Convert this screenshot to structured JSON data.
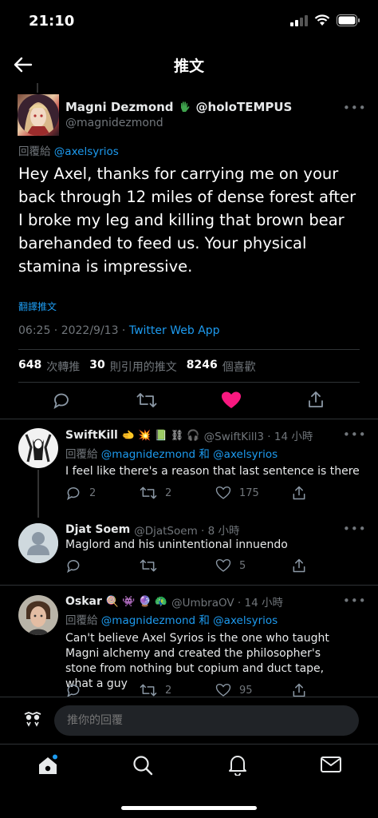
{
  "status_bar": {
    "time": "21:10"
  },
  "header": {
    "title": "推文"
  },
  "main_tweet": {
    "display_name": "Magni Dezmond",
    "handle_extra": "@holoTEMPUS",
    "username": "@magnidezmond",
    "reply_prefix": "回覆給",
    "reply_to": "@axelsyrios",
    "text": "Hey Axel, thanks for carrying me on your back through 12 miles of dense forest after I broke my leg and killing that brown bear barehanded to feed us. Your physical stamina is impressive.",
    "translate": "翻譯推文",
    "timestamp": "06:25 · 2022/9/13 · ",
    "source": "Twitter Web App",
    "stats": {
      "retweets": "648",
      "retweets_label": "次轉推",
      "quotes": "30",
      "quotes_label": "則引用的推文",
      "likes": "8246",
      "likes_label": "個喜歡"
    }
  },
  "replies": [
    {
      "display_name": "SwiftKill",
      "emojis": "🫲 💥 📗 ⛓ 🎧",
      "meta": "@SwiftKill3 · 14 小時",
      "reply_prefix": "回覆給",
      "reply_to": "@magnidezmond 和 @axelsyrios",
      "text": "I feel like there's a reason that last sentence is there",
      "replies": "2",
      "retweets": "2",
      "likes": "175"
    },
    {
      "display_name": "Djat Soem",
      "meta": "@DjatSoem · 8 小時",
      "text": "Maglord and his unintentional innuendo",
      "likes": "5"
    },
    {
      "display_name": "Oskar",
      "emojis": "🍭 👾 🔮 🦚",
      "meta": "@UmbraOV · 14 小時",
      "reply_prefix": "回覆給",
      "reply_to": "@magnidezmond 和 @axelsyrios",
      "text": "Can't believe Axel Syrios is the one who taught Magni alchemy and created the philosopher's stone from nothing but copium and duct tape, what a guy",
      "retweets": "2",
      "likes": "95"
    }
  ],
  "composer": {
    "placeholder": "推你的回覆"
  },
  "colors": {
    "accent": "#1d9bf0",
    "like": "#f91880",
    "muted": "#71767b",
    "divider": "#2f3336"
  }
}
